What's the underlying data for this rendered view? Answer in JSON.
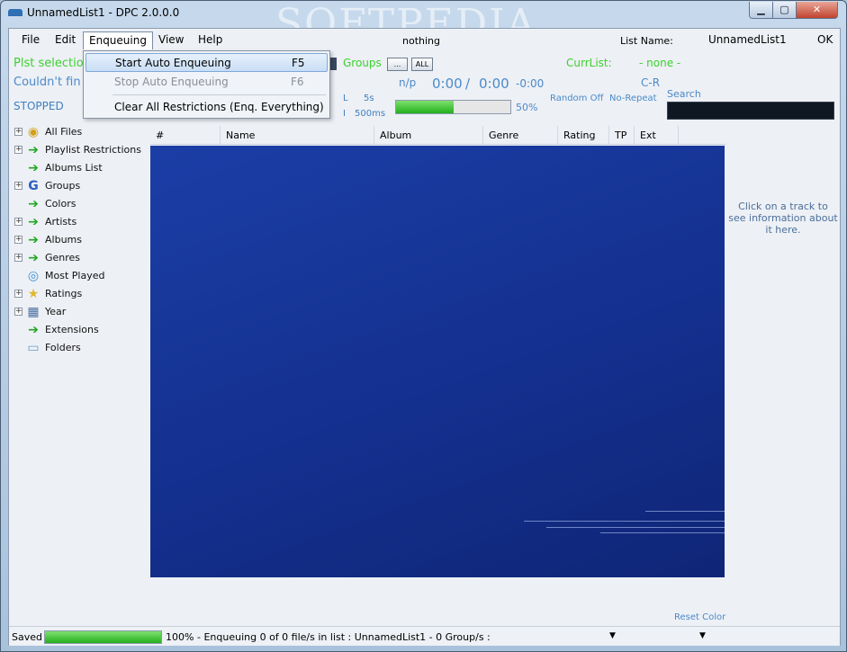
{
  "window": {
    "title": "UnnamedList1  -  DPC 2.0.0.0",
    "watermark": "SOFTPEDIA",
    "caption_buttons": {
      "minimize": "▁",
      "maximize": "▢",
      "close": "✕"
    }
  },
  "menubar": {
    "items": [
      "File",
      "Edit",
      "Enqueuing",
      "View",
      "Help"
    ],
    "nothing": "nothing",
    "list_name_label": "List Name:",
    "list_name_value": "UnnamedList1",
    "ok": "OK"
  },
  "enqueuing_menu": {
    "items": [
      {
        "label": "Start Auto Enqueuing",
        "shortcut": "F5",
        "state": "highlighted"
      },
      {
        "label": "Stop Auto Enqueuing",
        "shortcut": "F6",
        "state": "disabled"
      },
      {
        "label": "Clear All Restrictions (Enq. Everything)",
        "shortcut": "",
        "state": "normal"
      }
    ]
  },
  "status": {
    "plst_selection": "Plst selectio",
    "couldnt_find": "Couldn't fin",
    "state": "STOPPED",
    "groups_label": "Groups",
    "groups_btn_more": "...",
    "groups_btn_all": "ALL",
    "currlist_label": "CurrList:",
    "currlist_value": "- none -",
    "np_label": "n/p",
    "time_elapsed": "0:00",
    "time_sep": "/",
    "time_total": "0:00",
    "time_remaining": "-0:00",
    "cr_label": "C-R",
    "l_label": "L",
    "l_value": "5s",
    "i_label": "I",
    "i_value": "500ms",
    "progress_percent_label": "50%",
    "progress_fraction": 0.5,
    "random": "Random Off",
    "repeat": "No-Repeat",
    "search_label": "Search",
    "search_value": ""
  },
  "tree": {
    "items": [
      {
        "label": "All Files",
        "icon": "cd-icon",
        "expandable": true
      },
      {
        "label": "Playlist Restrictions",
        "icon": "arrow-icon",
        "expandable": true
      },
      {
        "label": "Albums List",
        "icon": "arrow-icon",
        "expandable": false
      },
      {
        "label": "Groups",
        "icon": "g-icon",
        "expandable": true
      },
      {
        "label": "Colors",
        "icon": "arrow-icon",
        "expandable": false
      },
      {
        "label": "Artists",
        "icon": "arrow-icon",
        "expandable": true
      },
      {
        "label": "Albums",
        "icon": "arrow-icon",
        "expandable": true
      },
      {
        "label": "Genres",
        "icon": "arrow-icon",
        "expandable": true
      },
      {
        "label": "Most Played",
        "icon": "disc-icon",
        "expandable": false
      },
      {
        "label": "Ratings",
        "icon": "star-icon",
        "expandable": true
      },
      {
        "label": "Year",
        "icon": "calendar-icon",
        "expandable": true
      },
      {
        "label": "Extensions",
        "icon": "arrow-icon",
        "expandable": false
      },
      {
        "label": "Folders",
        "icon": "folder-icon",
        "expandable": false
      }
    ]
  },
  "table": {
    "columns": [
      "#",
      "Name",
      "Album",
      "Genre",
      "Rating",
      "TP",
      "Ext"
    ],
    "rows": []
  },
  "info_panel": {
    "message": "Click on a track to see information about it here.",
    "reset_color": "Reset Color"
  },
  "statusbar": {
    "saved": "Saved",
    "progress_percent_label": "100%",
    "progress_fraction": 1.0,
    "text": "-  Enqueuing  0  of  0  file/s in list :  UnnamedList1  -  0  Group/s :"
  },
  "colors": {
    "green_text": "#3cd12e",
    "blue_text": "#4b8ac9",
    "list_background": "#1b3ea6",
    "progress_green": "#22b01c"
  }
}
